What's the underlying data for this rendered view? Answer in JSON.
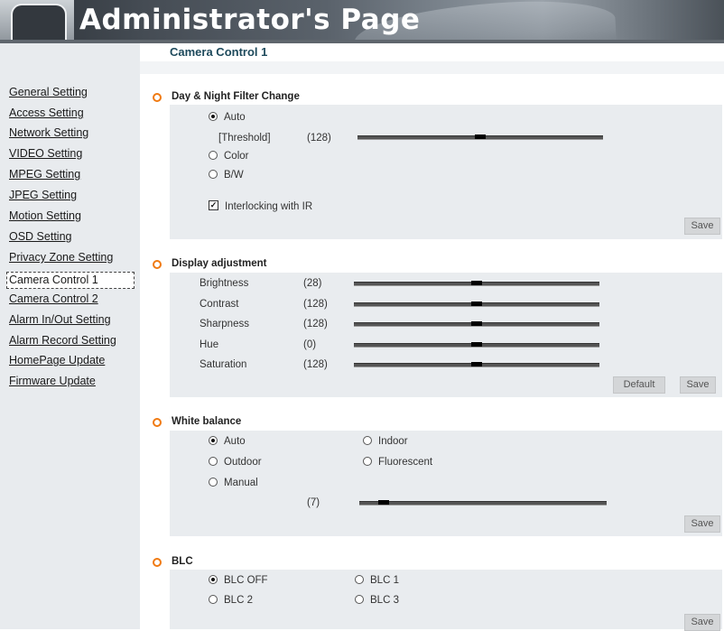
{
  "header": {
    "title": "Administrator's Page"
  },
  "page_title": "Camera Control 1",
  "sidebar": {
    "items": [
      {
        "label": "General Setting"
      },
      {
        "label": "Access Setting"
      },
      {
        "label": "Network Setting"
      },
      {
        "label": "VIDEO Setting"
      },
      {
        "label": "MPEG Setting"
      },
      {
        "label": "JPEG Setting"
      },
      {
        "label": "Motion Setting"
      },
      {
        "label": "OSD Setting"
      },
      {
        "label": "Privacy Zone Setting"
      },
      {
        "label": "Camera Control 1",
        "active": true
      },
      {
        "label": "Camera Control 2"
      },
      {
        "label": "Alarm In/Out Setting"
      },
      {
        "label": "Alarm Record Setting"
      },
      {
        "label": "HomePage Update"
      },
      {
        "label": "Firmware Update"
      }
    ]
  },
  "day_night": {
    "title": "Day & Night Filter Change",
    "auto": "Auto",
    "threshold_label": "[Threshold]",
    "threshold_value": "(128)",
    "threshold_level": 0.5,
    "color": "Color",
    "bw": "B/W",
    "selected": "Auto",
    "interlock_label": "Interlocking with IR",
    "interlock_checked": true,
    "save": "Save"
  },
  "display": {
    "title": "Display adjustment",
    "rows": [
      {
        "label": "Brightness",
        "value": "(28)",
        "level": 0.5
      },
      {
        "label": "Contrast",
        "value": "(128)",
        "level": 0.5
      },
      {
        "label": "Sharpness",
        "value": "(128)",
        "level": 0.5
      },
      {
        "label": "Hue",
        "value": "(0)",
        "level": 0.5
      },
      {
        "label": "Saturation",
        "value": "(128)",
        "level": 0.5
      }
    ],
    "default": "Default",
    "save": "Save"
  },
  "white_balance": {
    "title": "White balance",
    "auto": "Auto",
    "indoor": "Indoor",
    "outdoor": "Outdoor",
    "fluorescent": "Fluorescent",
    "manual": "Manual",
    "selected": "Auto",
    "manual_value": "(7)",
    "manual_level": 0.1,
    "save": "Save"
  },
  "blc": {
    "title": "BLC",
    "off": "BLC OFF",
    "blc1": "BLC 1",
    "blc2": "BLC 2",
    "blc3": "BLC 3",
    "selected": "BLC OFF",
    "save": "Save"
  },
  "colors": {
    "accent_orange": "#f07a12",
    "sidebar_bg": "#e8ebee",
    "panel_bg": "#e9ecef",
    "title_teal": "#1e4a5c"
  }
}
